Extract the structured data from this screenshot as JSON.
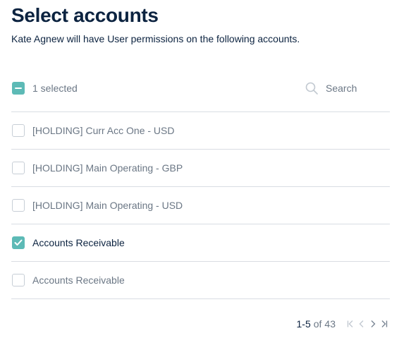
{
  "header": {
    "title": "Select accounts",
    "subtitle": "Kate Agnew will have User permissions on the following accounts."
  },
  "toolbar": {
    "selected_label": "1 selected",
    "search_placeholder": "Search"
  },
  "accounts": [
    {
      "name": "[HOLDING] Curr Acc One - USD",
      "checked": false
    },
    {
      "name": "[HOLDING] Main Operating - GBP",
      "checked": false
    },
    {
      "name": "[HOLDING] Main Operating - USD",
      "checked": false
    },
    {
      "name": "Accounts Receivable",
      "checked": true
    },
    {
      "name": "Accounts Receivable",
      "checked": false
    }
  ],
  "pagination": {
    "range": "1-5",
    "of": "of",
    "total": "43"
  },
  "colors": {
    "accent": "#5dbab6",
    "text_primary": "#0c2340",
    "text_muted": "#6b7785",
    "divider": "#d9dde3"
  },
  "icons": {
    "search": "search-icon",
    "first_page": "first-page-icon",
    "prev_page": "prev-page-icon",
    "next_page": "next-page-icon",
    "last_page": "last-page-icon"
  }
}
